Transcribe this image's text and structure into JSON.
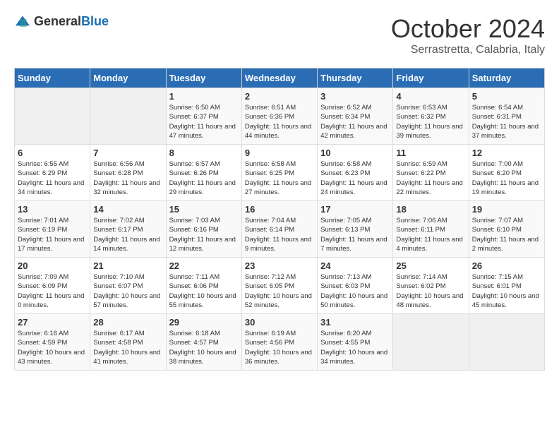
{
  "header": {
    "logo": {
      "general": "General",
      "blue": "Blue"
    },
    "title": "October 2024",
    "location": "Serrastretta, Calabria, Italy"
  },
  "calendar": {
    "weekdays": [
      "Sunday",
      "Monday",
      "Tuesday",
      "Wednesday",
      "Thursday",
      "Friday",
      "Saturday"
    ],
    "weeks": [
      [
        {
          "day": "",
          "empty": true
        },
        {
          "day": "",
          "empty": true
        },
        {
          "day": "1",
          "sunrise": "Sunrise: 6:50 AM",
          "sunset": "Sunset: 6:37 PM",
          "daylight": "Daylight: 11 hours and 47 minutes."
        },
        {
          "day": "2",
          "sunrise": "Sunrise: 6:51 AM",
          "sunset": "Sunset: 6:36 PM",
          "daylight": "Daylight: 11 hours and 44 minutes."
        },
        {
          "day": "3",
          "sunrise": "Sunrise: 6:52 AM",
          "sunset": "Sunset: 6:34 PM",
          "daylight": "Daylight: 11 hours and 42 minutes."
        },
        {
          "day": "4",
          "sunrise": "Sunrise: 6:53 AM",
          "sunset": "Sunset: 6:32 PM",
          "daylight": "Daylight: 11 hours and 39 minutes."
        },
        {
          "day": "5",
          "sunrise": "Sunrise: 6:54 AM",
          "sunset": "Sunset: 6:31 PM",
          "daylight": "Daylight: 11 hours and 37 minutes."
        }
      ],
      [
        {
          "day": "6",
          "sunrise": "Sunrise: 6:55 AM",
          "sunset": "Sunset: 6:29 PM",
          "daylight": "Daylight: 11 hours and 34 minutes."
        },
        {
          "day": "7",
          "sunrise": "Sunrise: 6:56 AM",
          "sunset": "Sunset: 6:28 PM",
          "daylight": "Daylight: 11 hours and 32 minutes."
        },
        {
          "day": "8",
          "sunrise": "Sunrise: 6:57 AM",
          "sunset": "Sunset: 6:26 PM",
          "daylight": "Daylight: 11 hours and 29 minutes."
        },
        {
          "day": "9",
          "sunrise": "Sunrise: 6:58 AM",
          "sunset": "Sunset: 6:25 PM",
          "daylight": "Daylight: 11 hours and 27 minutes."
        },
        {
          "day": "10",
          "sunrise": "Sunrise: 6:58 AM",
          "sunset": "Sunset: 6:23 PM",
          "daylight": "Daylight: 11 hours and 24 minutes."
        },
        {
          "day": "11",
          "sunrise": "Sunrise: 6:59 AM",
          "sunset": "Sunset: 6:22 PM",
          "daylight": "Daylight: 11 hours and 22 minutes."
        },
        {
          "day": "12",
          "sunrise": "Sunrise: 7:00 AM",
          "sunset": "Sunset: 6:20 PM",
          "daylight": "Daylight: 11 hours and 19 minutes."
        }
      ],
      [
        {
          "day": "13",
          "sunrise": "Sunrise: 7:01 AM",
          "sunset": "Sunset: 6:19 PM",
          "daylight": "Daylight: 11 hours and 17 minutes."
        },
        {
          "day": "14",
          "sunrise": "Sunrise: 7:02 AM",
          "sunset": "Sunset: 6:17 PM",
          "daylight": "Daylight: 11 hours and 14 minutes."
        },
        {
          "day": "15",
          "sunrise": "Sunrise: 7:03 AM",
          "sunset": "Sunset: 6:16 PM",
          "daylight": "Daylight: 11 hours and 12 minutes."
        },
        {
          "day": "16",
          "sunrise": "Sunrise: 7:04 AM",
          "sunset": "Sunset: 6:14 PM",
          "daylight": "Daylight: 11 hours and 9 minutes."
        },
        {
          "day": "17",
          "sunrise": "Sunrise: 7:05 AM",
          "sunset": "Sunset: 6:13 PM",
          "daylight": "Daylight: 11 hours and 7 minutes."
        },
        {
          "day": "18",
          "sunrise": "Sunrise: 7:06 AM",
          "sunset": "Sunset: 6:11 PM",
          "daylight": "Daylight: 11 hours and 4 minutes."
        },
        {
          "day": "19",
          "sunrise": "Sunrise: 7:07 AM",
          "sunset": "Sunset: 6:10 PM",
          "daylight": "Daylight: 11 hours and 2 minutes."
        }
      ],
      [
        {
          "day": "20",
          "sunrise": "Sunrise: 7:09 AM",
          "sunset": "Sunset: 6:09 PM",
          "daylight": "Daylight: 11 hours and 0 minutes."
        },
        {
          "day": "21",
          "sunrise": "Sunrise: 7:10 AM",
          "sunset": "Sunset: 6:07 PM",
          "daylight": "Daylight: 10 hours and 57 minutes."
        },
        {
          "day": "22",
          "sunrise": "Sunrise: 7:11 AM",
          "sunset": "Sunset: 6:06 PM",
          "daylight": "Daylight: 10 hours and 55 minutes."
        },
        {
          "day": "23",
          "sunrise": "Sunrise: 7:12 AM",
          "sunset": "Sunset: 6:05 PM",
          "daylight": "Daylight: 10 hours and 52 minutes."
        },
        {
          "day": "24",
          "sunrise": "Sunrise: 7:13 AM",
          "sunset": "Sunset: 6:03 PM",
          "daylight": "Daylight: 10 hours and 50 minutes."
        },
        {
          "day": "25",
          "sunrise": "Sunrise: 7:14 AM",
          "sunset": "Sunset: 6:02 PM",
          "daylight": "Daylight: 10 hours and 48 minutes."
        },
        {
          "day": "26",
          "sunrise": "Sunrise: 7:15 AM",
          "sunset": "Sunset: 6:01 PM",
          "daylight": "Daylight: 10 hours and 45 minutes."
        }
      ],
      [
        {
          "day": "27",
          "sunrise": "Sunrise: 6:16 AM",
          "sunset": "Sunset: 4:59 PM",
          "daylight": "Daylight: 10 hours and 43 minutes."
        },
        {
          "day": "28",
          "sunrise": "Sunrise: 6:17 AM",
          "sunset": "Sunset: 4:58 PM",
          "daylight": "Daylight: 10 hours and 41 minutes."
        },
        {
          "day": "29",
          "sunrise": "Sunrise: 6:18 AM",
          "sunset": "Sunset: 4:57 PM",
          "daylight": "Daylight: 10 hours and 38 minutes."
        },
        {
          "day": "30",
          "sunrise": "Sunrise: 6:19 AM",
          "sunset": "Sunset: 4:56 PM",
          "daylight": "Daylight: 10 hours and 36 minutes."
        },
        {
          "day": "31",
          "sunrise": "Sunrise: 6:20 AM",
          "sunset": "Sunset: 4:55 PM",
          "daylight": "Daylight: 10 hours and 34 minutes."
        },
        {
          "day": "",
          "empty": true
        },
        {
          "day": "",
          "empty": true
        }
      ]
    ]
  }
}
